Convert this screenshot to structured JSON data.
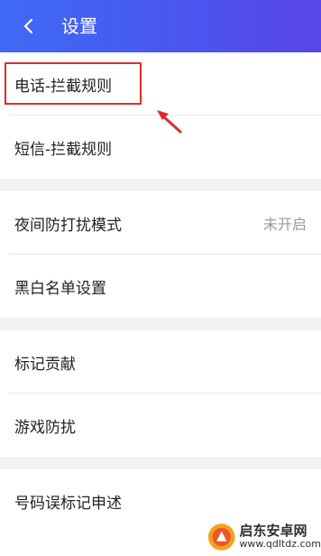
{
  "header": {
    "title": "设置"
  },
  "groups": [
    {
      "rows": [
        {
          "label": "电话-拦截规则"
        },
        {
          "label": "短信-拦截规则"
        }
      ]
    },
    {
      "rows": [
        {
          "label": "夜间防打扰模式",
          "value": "未开启"
        },
        {
          "label": "黑白名单设置"
        }
      ]
    },
    {
      "rows": [
        {
          "label": "标记贡献"
        },
        {
          "label": "游戏防扰"
        }
      ]
    },
    {
      "rows": [
        {
          "label": "号码误标记申述"
        }
      ]
    }
  ],
  "annotation": {
    "color": "#e02a2a"
  },
  "watermark": {
    "title": "启东安卓网",
    "url": "www.qdltdz.com"
  }
}
